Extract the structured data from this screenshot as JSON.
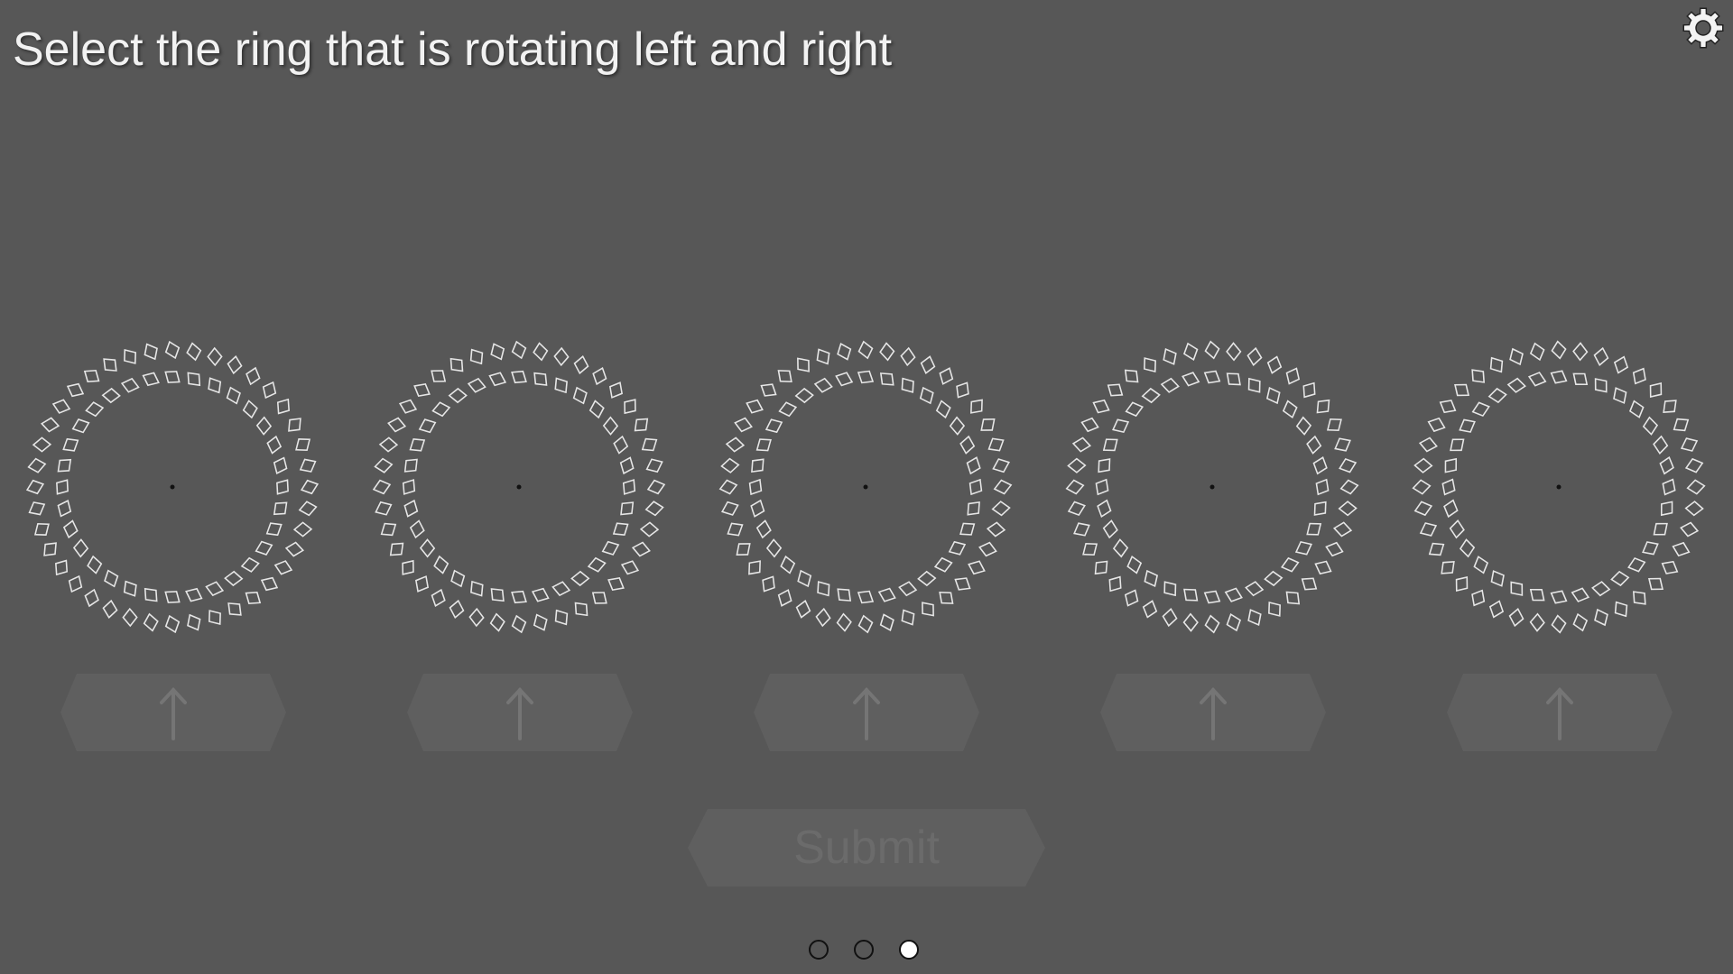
{
  "prompt": "Select the ring that is rotating left and right",
  "settings": {
    "icon": "gear-icon"
  },
  "rings": [
    {
      "name": "ring-1"
    },
    {
      "name": "ring-2"
    },
    {
      "name": "ring-3"
    },
    {
      "name": "ring-4"
    },
    {
      "name": "ring-5"
    }
  ],
  "select_buttons": {
    "icon": "up-arrow-icon",
    "count": 5
  },
  "submit": {
    "label": "Submit"
  },
  "pager": {
    "total": 3,
    "current": 3
  },
  "colors": {
    "background": "#575757",
    "ring_square_stroke": "#e6e6e6",
    "button_fill": "#5f5f5f",
    "button_arrow": "#757575",
    "submit_text": "#6b6b6b",
    "prompt_text": "#f2f2f2"
  }
}
